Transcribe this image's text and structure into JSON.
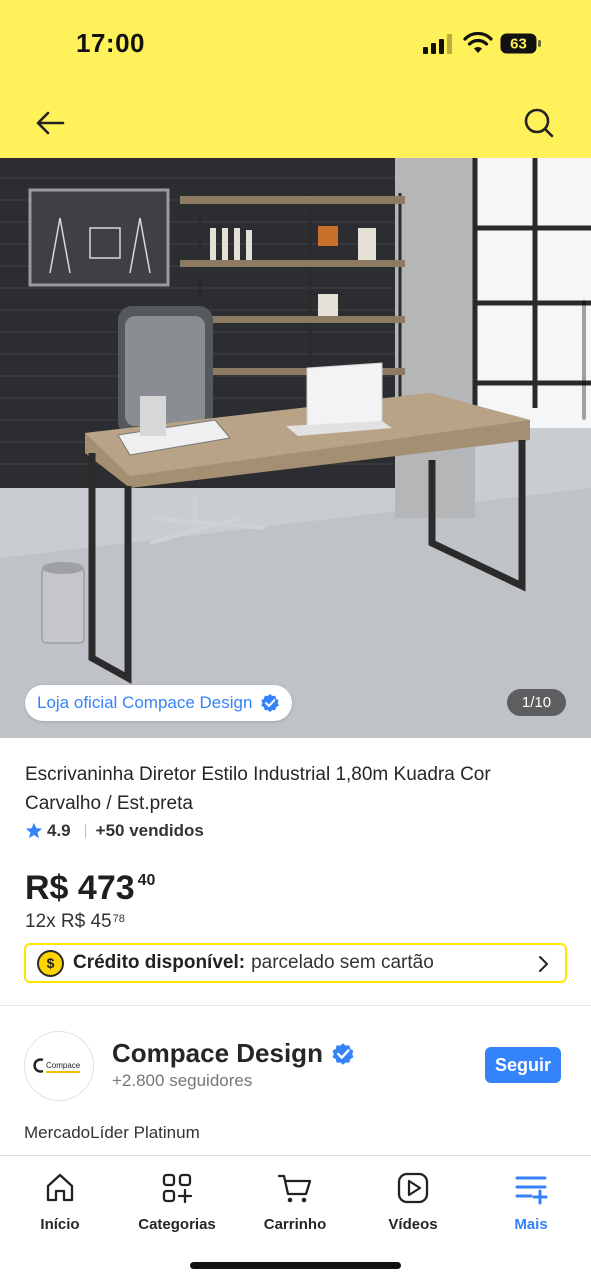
{
  "status_bar": {
    "time": "17:00",
    "battery": "63"
  },
  "header": {
    "back_icon": "arrow-left-icon",
    "search_icon": "search-icon",
    "background": "#fff159"
  },
  "product": {
    "official_store": "Loja oficial Compace Design",
    "image_counter": "1/10",
    "title": "Escrivaninha Diretor Estilo Industrial 1,80m Kuadra Cor Carvalho / Est.preta",
    "rating": "4.9",
    "sold": "+50 vendidos",
    "price_main": "R$ 473",
    "price_cents": "40",
    "installments_main": "12x R$ 45",
    "installments_cents": "78"
  },
  "credit": {
    "label": "Crédito disponível:",
    "description": "parcelado sem cartão",
    "icon": "coin-icon"
  },
  "seller": {
    "logo_text": "Compace",
    "name": "Compace Design",
    "followers": "+2.800 seguidores",
    "follow_label": "Seguir",
    "level": "MercadoLíder Platinum"
  },
  "bottom_nav": {
    "items": [
      {
        "label": "Início",
        "icon": "home-icon"
      },
      {
        "label": "Categorias",
        "icon": "categories-icon"
      },
      {
        "label": "Carrinho",
        "icon": "cart-icon"
      },
      {
        "label": "Vídeos",
        "icon": "video-icon"
      },
      {
        "label": "Mais",
        "icon": "menu-plus-icon"
      }
    ],
    "active_index": 4
  },
  "colors": {
    "accent": "#3483fa",
    "yellow": "#fff159",
    "credit_border": "#ffe600"
  }
}
